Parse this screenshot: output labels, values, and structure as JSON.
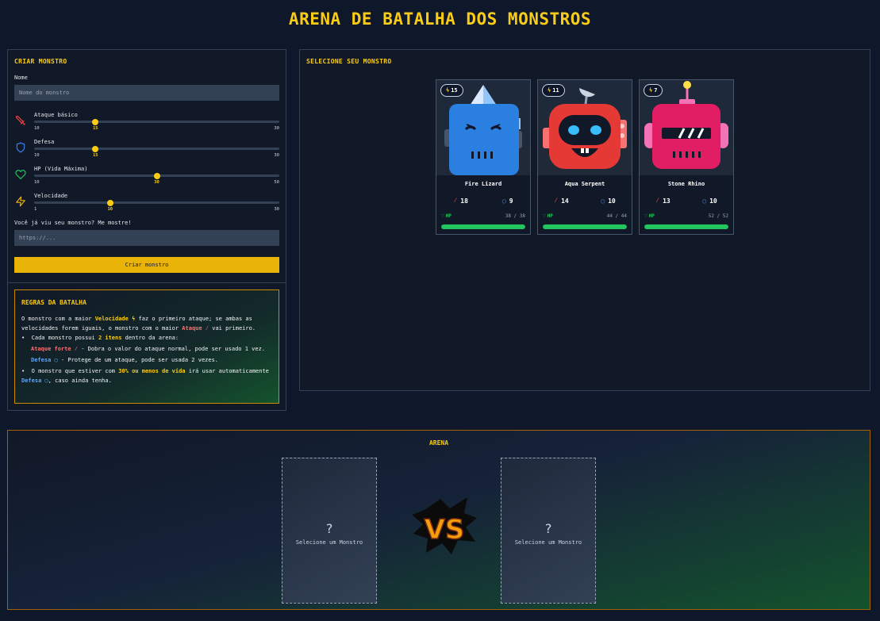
{
  "page": {
    "title": "ARENA DE BATALHA DOS MONSTROS"
  },
  "create": {
    "title": "CRIAR MONSTRO",
    "name_label": "Nome",
    "name_placeholder": "Nome do monstro",
    "stats": [
      {
        "name": "Ataque básico",
        "icon": "sword-icon",
        "min": "10",
        "value": "15",
        "max": "30",
        "fraction": 0.25
      },
      {
        "name": "Defesa",
        "icon": "shield-icon",
        "min": "10",
        "value": "15",
        "max": "30",
        "fraction": 0.25
      },
      {
        "name": "HP (Vida Máxima)",
        "icon": "heart-icon",
        "min": "10",
        "value": "30",
        "max": "50",
        "fraction": 0.5
      },
      {
        "name": "Velocidade",
        "icon": "lightning-icon",
        "min": "1",
        "value": "10",
        "max": "30",
        "fraction": 0.31
      }
    ],
    "image_label": "Você já viu seu monstro? Me mostre!",
    "image_placeholder": "https://...",
    "button": "Criar monstro"
  },
  "rules": {
    "title": "REGRAS DA BATALHA",
    "p1_a": "O monstro com a maior ",
    "p1_speed": "Velocidade",
    "p1_b": " faz o primeiro ataque; se ambas as velocidades forem iguais, o monstro com o maior ",
    "p1_attack": "Ataque",
    "p1_c": " vai primeiro.",
    "p2_a": "Cada monstro possui ",
    "p2_items": "2 itens",
    "p2_b": " dentro da arena:",
    "item1_name": "Ataque forte",
    "item1_desc": " - Dobra o valor do ataque normal, pode ser usado 1 vez.",
    "item2_name": "Defesa",
    "item2_desc": " - Protege de um ataque, pode ser usada 2 vezes.",
    "p3_a": "O monstro que estiver com ",
    "p3_pct": "30% ou menos de vida",
    "p3_b": " irá usar automaticamente ",
    "p3_def": "Defesa",
    "p3_c": ", caso ainda tenha."
  },
  "select": {
    "title": "SELECIONE SEU MONSTRO",
    "monsters": [
      {
        "name": "Fire Lizard",
        "speed": "15",
        "attack": "18",
        "defense": "9",
        "hp_label": "HP",
        "hp": "38 / 38",
        "hp_fraction": 1.0,
        "color": "#2b7fe0"
      },
      {
        "name": "Aqua Serpent",
        "speed": "11",
        "attack": "14",
        "defense": "10",
        "hp_label": "HP",
        "hp": "44 / 44",
        "hp_fraction": 1.0,
        "color": "#e53935"
      },
      {
        "name": "Stone Rhino",
        "speed": "7",
        "attack": "13",
        "defense": "10",
        "hp_label": "HP",
        "hp": "52 / 52",
        "hp_fraction": 1.0,
        "color": "#e11d63"
      }
    ]
  },
  "arena": {
    "title": "ARENA",
    "left_q": "?",
    "left_text": "Selecione um Monstro",
    "right_q": "?",
    "right_text": "Selecione um Monstro",
    "vs": "VS"
  },
  "colors": {
    "accent": "#facc15",
    "hp": "#22c55e",
    "attack": "#f87171",
    "defense": "#60a5fa"
  }
}
